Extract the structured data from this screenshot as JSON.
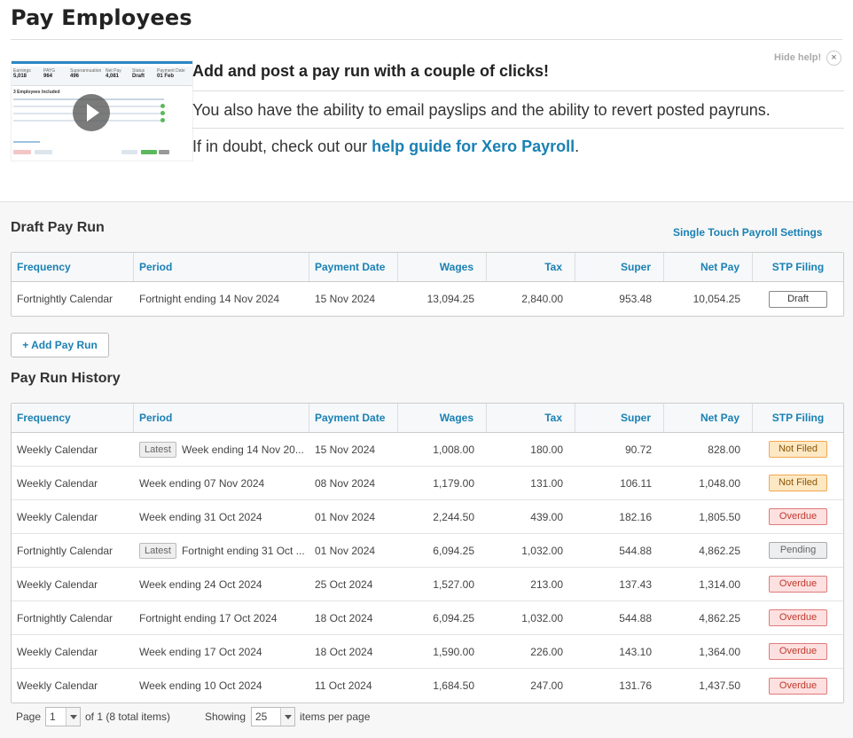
{
  "page": {
    "title": "Pay Employees"
  },
  "help": {
    "heading": "Add and post a pay run with a couple of clicks!",
    "line1": "You also have the ability to email payslips and the ability to revert posted payruns.",
    "line2_prefix": "If in doubt, check out our ",
    "line2_link": "help guide for Xero Payroll",
    "line2_suffix": ".",
    "hide_label": "Hide help!",
    "close_glyph": "×",
    "thumbnail": {
      "stats": [
        {
          "label": "Earnings",
          "value": "5,018"
        },
        {
          "label": "PAYG",
          "value": "964"
        },
        {
          "label": "Superannuation",
          "value": "496"
        },
        {
          "label": "Net Pay",
          "value": "4,081"
        },
        {
          "label": "Status",
          "value": "Draft"
        },
        {
          "label": "Payment Date",
          "value": "01 Feb"
        }
      ],
      "caption": "3 Employees Included"
    }
  },
  "draft": {
    "title": "Draft Pay Run",
    "stp_link": "Single Touch Payroll Settings",
    "rows": [
      {
        "freq": "Fortnightly Calendar",
        "latest": "",
        "period": "Fortnight ending 14 Nov 2024",
        "date": "15 Nov 2024",
        "wages": "13,094.25",
        "tax": "2,840.00",
        "super": "953.48",
        "net": "10,054.25",
        "stp": "Draft",
        "stp_class": "b-draft"
      }
    ]
  },
  "headers": {
    "freq": "Frequency",
    "period": "Period",
    "date": "Payment Date",
    "wages": "Wages",
    "tax": "Tax",
    "super": "Super",
    "net": "Net Pay",
    "stp": "STP Filing"
  },
  "add_button": "+ Add Pay Run",
  "history": {
    "title": "Pay Run History",
    "rows": [
      {
        "freq": "Weekly Calendar",
        "latest": "Latest",
        "period": "Week ending 14 Nov 20...",
        "date": "15 Nov 2024",
        "wages": "1,008.00",
        "tax": "180.00",
        "super": "90.72",
        "net": "828.00",
        "stp": "Not Filed",
        "stp_class": "b-notfiled"
      },
      {
        "freq": "Weekly Calendar",
        "latest": "",
        "period": "Week ending 07 Nov 2024",
        "date": "08 Nov 2024",
        "wages": "1,179.00",
        "tax": "131.00",
        "super": "106.11",
        "net": "1,048.00",
        "stp": "Not Filed",
        "stp_class": "b-notfiled"
      },
      {
        "freq": "Weekly Calendar",
        "latest": "",
        "period": "Week ending 31 Oct 2024",
        "date": "01 Nov 2024",
        "wages": "2,244.50",
        "tax": "439.00",
        "super": "182.16",
        "net": "1,805.50",
        "stp": "Overdue",
        "stp_class": "b-overdue"
      },
      {
        "freq": "Fortnightly Calendar",
        "latest": "Latest",
        "period": "Fortnight ending 31 Oct ...",
        "date": "01 Nov 2024",
        "wages": "6,094.25",
        "tax": "1,032.00",
        "super": "544.88",
        "net": "4,862.25",
        "stp": "Pending",
        "stp_class": "b-pending"
      },
      {
        "freq": "Weekly Calendar",
        "latest": "",
        "period": "Week ending 24 Oct 2024",
        "date": "25 Oct 2024",
        "wages": "1,527.00",
        "tax": "213.00",
        "super": "137.43",
        "net": "1,314.00",
        "stp": "Overdue",
        "stp_class": "b-overdue"
      },
      {
        "freq": "Fortnightly Calendar",
        "latest": "",
        "period": "Fortnight ending 17 Oct 2024",
        "date": "18 Oct 2024",
        "wages": "6,094.25",
        "tax": "1,032.00",
        "super": "544.88",
        "net": "4,862.25",
        "stp": "Overdue",
        "stp_class": "b-overdue"
      },
      {
        "freq": "Weekly Calendar",
        "latest": "",
        "period": "Week ending 17 Oct 2024",
        "date": "18 Oct 2024",
        "wages": "1,590.00",
        "tax": "226.00",
        "super": "143.10",
        "net": "1,364.00",
        "stp": "Overdue",
        "stp_class": "b-overdue"
      },
      {
        "freq": "Weekly Calendar",
        "latest": "",
        "period": "Week ending 10 Oct 2024",
        "date": "11 Oct 2024",
        "wages": "1,684.50",
        "tax": "247.00",
        "super": "131.76",
        "net": "1,437.50",
        "stp": "Overdue",
        "stp_class": "b-overdue"
      }
    ]
  },
  "pager": {
    "page_label": "Page",
    "page_value": "1",
    "of_label": "of 1 (8 total items)",
    "showing_label": "Showing",
    "showing_value": "25",
    "per_page_label": "items per page"
  },
  "colors": {
    "link": "#1a81b3",
    "not_filed": "#fde8c4",
    "overdue": "#fde0e0",
    "pending": "#eceef0"
  }
}
